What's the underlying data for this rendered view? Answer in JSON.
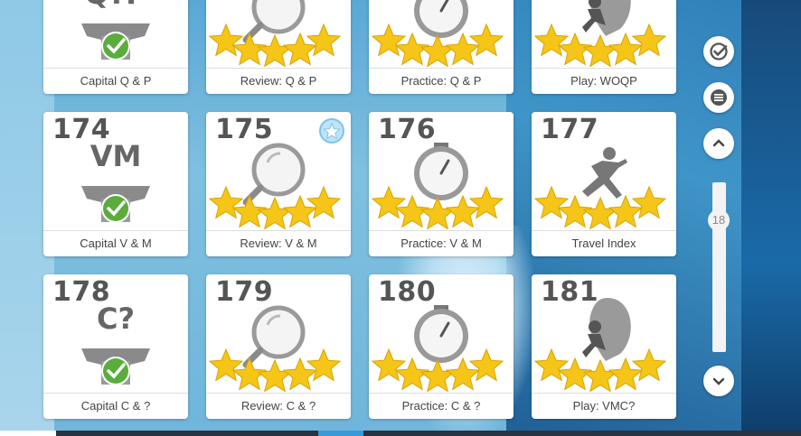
{
  "tiles": [
    {
      "number": "",
      "title": "Capital Q & P",
      "type": "capital",
      "medal_text": "Q?P"
    },
    {
      "number": "",
      "title": "Review: Q & P",
      "type": "review"
    },
    {
      "number": "",
      "title": "Practice: Q & P",
      "type": "practice"
    },
    {
      "number": "",
      "title": "Play: WOQP",
      "type": "play-balloon"
    },
    {
      "number": "174",
      "title": "Capital V & M",
      "type": "capital",
      "medal_text": "VM"
    },
    {
      "number": "175",
      "title": "Review: V & M",
      "type": "review",
      "badge": "star-badge-icon"
    },
    {
      "number": "176",
      "title": "Practice: V & M",
      "type": "practice"
    },
    {
      "number": "177",
      "title": "Travel Index",
      "type": "play-runner"
    },
    {
      "number": "178",
      "title": "Capital C & ?",
      "type": "capital",
      "medal_text": "C?"
    },
    {
      "number": "179",
      "title": "Review: C & ?",
      "type": "review"
    },
    {
      "number": "180",
      "title": "Practice: C & ?",
      "type": "practice"
    },
    {
      "number": "181",
      "title": "Play: VMC?",
      "type": "play-balloon"
    }
  ],
  "sidebar": {
    "check_icon": "check-circle-icon",
    "menu_icon": "menu-icon",
    "up_icon": "chevron-up-icon",
    "down_icon": "chevron-down-icon",
    "scroll_label": "18"
  },
  "colors": {
    "star": "#f5c518",
    "check": "#5aad3c",
    "gray": "#777777",
    "accent": "#3a9ad9"
  }
}
